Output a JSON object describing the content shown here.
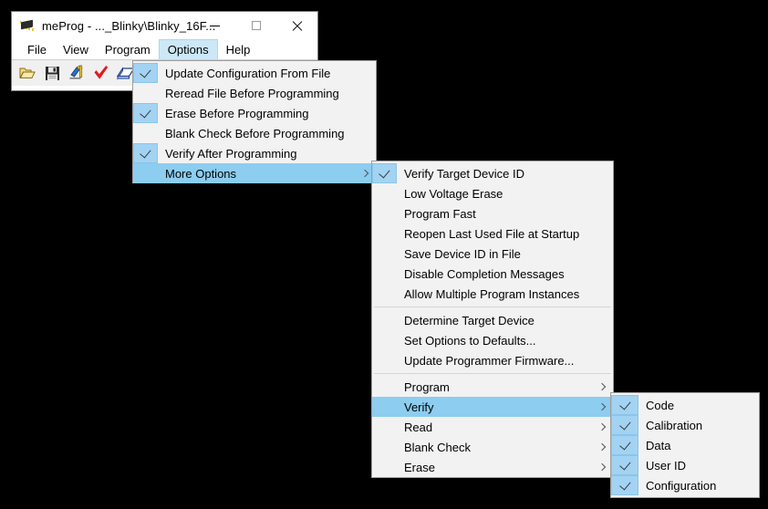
{
  "window": {
    "title": "meProg - ..._Blinky\\Blinky_16F...",
    "app_icon": "microchip-icon",
    "buttons": {
      "minimize": "minimize-button",
      "maximize": "maximize-button",
      "close": "close-button"
    }
  },
  "menubar": {
    "items": [
      {
        "label": "File",
        "active": false
      },
      {
        "label": "View",
        "active": false
      },
      {
        "label": "Program",
        "active": false
      },
      {
        "label": "Options",
        "active": true
      },
      {
        "label": "Help",
        "active": false
      }
    ]
  },
  "toolbar": {
    "buttons": [
      {
        "name": "open-file-icon",
        "glyph": "📂"
      },
      {
        "name": "save-file-icon",
        "glyph": "💾"
      },
      {
        "name": "program-device-icon",
        "glyph": "🖊"
      },
      {
        "name": "verify-check-icon",
        "glyph": "✔"
      },
      {
        "name": "read-device-icon",
        "glyph": "📘"
      },
      {
        "name": "blank-check-icon",
        "glyph": "💡"
      }
    ]
  },
  "menu_options": {
    "items": [
      {
        "label": "Update Configuration From File",
        "checked": true,
        "highlight": false,
        "submenu": false
      },
      {
        "label": "Reread File Before Programming",
        "checked": false,
        "highlight": false,
        "submenu": false
      },
      {
        "label": "Erase Before Programming",
        "checked": true,
        "highlight": false,
        "submenu": false
      },
      {
        "label": "Blank Check Before Programming",
        "checked": false,
        "highlight": false,
        "submenu": false
      },
      {
        "label": "Verify After Programming",
        "checked": true,
        "highlight": false,
        "submenu": false
      },
      {
        "label": "More Options",
        "checked": false,
        "highlight": true,
        "submenu": true
      }
    ]
  },
  "menu_more_options": {
    "groups": [
      {
        "items": [
          {
            "label": "Verify Target Device ID",
            "checked": true,
            "highlight": false,
            "submenu": false
          },
          {
            "label": "Low Voltage Erase",
            "checked": false,
            "highlight": false,
            "submenu": false
          },
          {
            "label": "Program Fast",
            "checked": false,
            "highlight": false,
            "submenu": false
          },
          {
            "label": "Reopen Last Used File at Startup",
            "checked": false,
            "highlight": false,
            "submenu": false
          },
          {
            "label": "Save Device ID in File",
            "checked": false,
            "highlight": false,
            "submenu": false
          },
          {
            "label": "Disable Completion Messages",
            "checked": false,
            "highlight": false,
            "submenu": false
          },
          {
            "label": "Allow Multiple Program Instances",
            "checked": false,
            "highlight": false,
            "submenu": false
          }
        ]
      },
      {
        "items": [
          {
            "label": "Determine Target Device",
            "checked": false,
            "highlight": false,
            "submenu": false
          },
          {
            "label": "Set Options to Defaults...",
            "checked": false,
            "highlight": false,
            "submenu": false
          },
          {
            "label": "Update Programmer Firmware...",
            "checked": false,
            "highlight": false,
            "submenu": false
          }
        ]
      },
      {
        "items": [
          {
            "label": "Program",
            "checked": false,
            "highlight": false,
            "submenu": true
          },
          {
            "label": "Verify",
            "checked": false,
            "highlight": true,
            "submenu": true
          },
          {
            "label": "Read",
            "checked": false,
            "highlight": false,
            "submenu": true
          },
          {
            "label": "Blank Check",
            "checked": false,
            "highlight": false,
            "submenu": true
          },
          {
            "label": "Erase",
            "checked": false,
            "highlight": false,
            "submenu": true
          }
        ]
      }
    ]
  },
  "menu_verify": {
    "items": [
      {
        "label": "Code",
        "checked": true,
        "highlight": false,
        "submenu": false
      },
      {
        "label": "Calibration",
        "checked": true,
        "highlight": false,
        "submenu": false
      },
      {
        "label": "Data",
        "checked": true,
        "highlight": false,
        "submenu": false
      },
      {
        "label": "User ID",
        "checked": true,
        "highlight": false,
        "submenu": false
      },
      {
        "label": "Configuration",
        "checked": true,
        "highlight": false,
        "submenu": false
      }
    ]
  },
  "colors": {
    "menu_bg": "#f2f2f2",
    "menu_border": "#9e9e9e",
    "highlight": "#8ccdf0",
    "check_cell": "#a3d3f2",
    "menubar_active": "#cce8f7",
    "desktop": "#000000"
  }
}
